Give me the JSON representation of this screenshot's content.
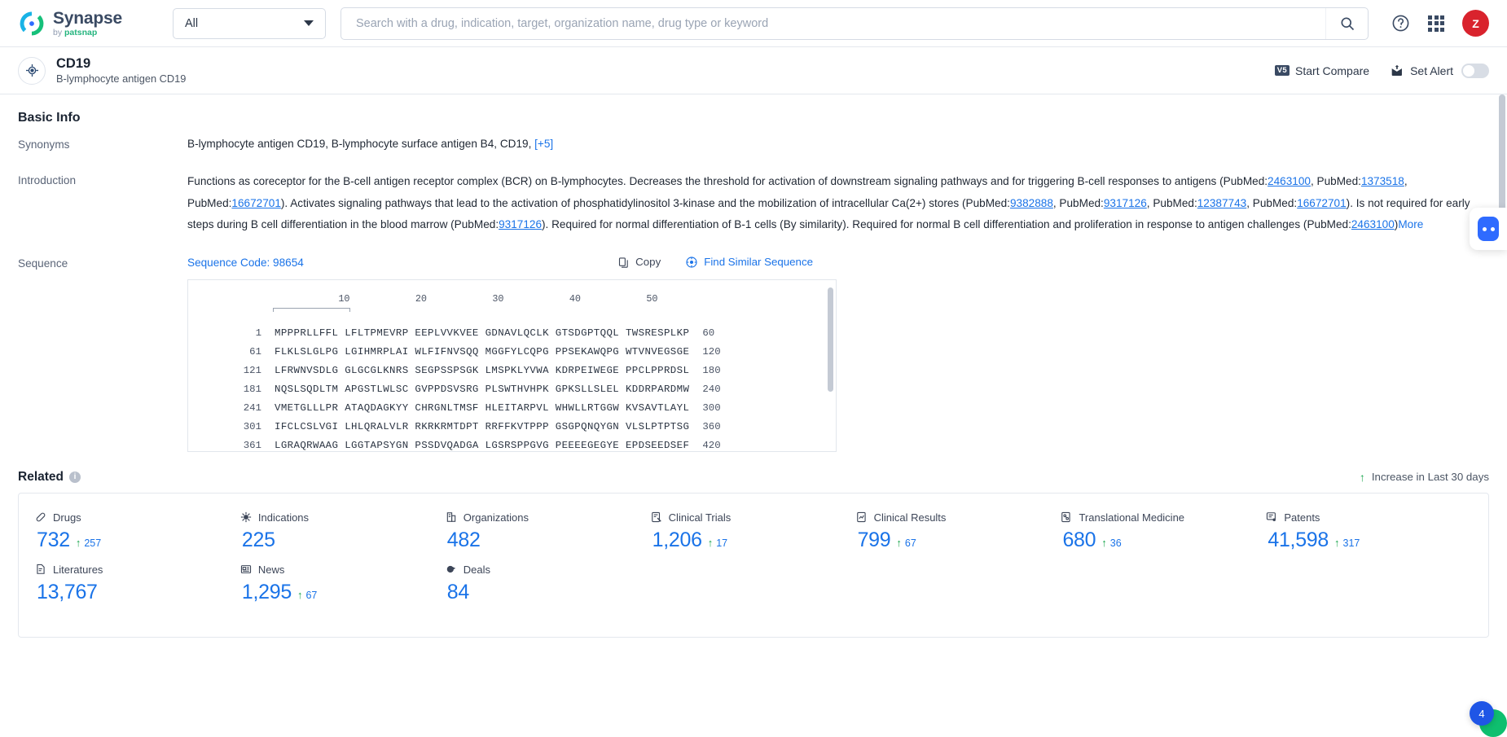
{
  "brand": {
    "name": "Synapse",
    "by": "by",
    "company": "patsnap",
    "logo_icon": "synapse-logo-icon"
  },
  "topbar": {
    "scope_value": "All",
    "scope_caret_icon": "chevron-down-icon",
    "search_placeholder": "Search with a drug, indication, target, organization name, drug type or keyword",
    "search_value": "",
    "search_icon": "search-icon",
    "help_icon": "help-circle-icon",
    "apps_icon": "apps-grid-icon",
    "avatar_initial": "Z"
  },
  "subheader": {
    "target_icon": "target-crosshair-icon",
    "title": "CD19",
    "subtitle": "B-lymphocyte antigen CD19",
    "start_compare_label": "Start Compare",
    "start_compare_badge": "V5",
    "set_alert_label": "Set Alert",
    "set_alert_icon": "bell-alert-icon",
    "alert_toggle_state": "off"
  },
  "basic_info": {
    "heading": "Basic Info",
    "synonyms_label": "Synonyms",
    "synonyms_value": "B-lymphocyte antigen CD19,  B-lymphocyte surface antigen B4,  CD19,",
    "synonyms_more": "[+5]",
    "introduction_label": "Introduction",
    "introduction_parts": {
      "t1": "Functions as coreceptor for the B-cell antigen receptor complex (BCR) on B-lymphocytes. Decreases the threshold for activation of downstream signaling pathways and for triggering B-cell responses to antigens (PubMed:",
      "l1": "2463100",
      "t2": ", PubMed:",
      "l2": "1373518",
      "t3": ", PubMed:",
      "l3": "16672701",
      "t4": "). Activates signaling pathways that lead to the activation of phosphatidylinositol 3-kinase and the mobilization of intracellular Ca(2+) stores (PubMed:",
      "l4": "9382888",
      "t5": ", PubMed:",
      "l5": "9317126",
      "t6": ", PubMed:",
      "l6": "12387743",
      "t7": ", PubMed:",
      "l7": "16672701",
      "t8": "). Is not required for early steps during B cell differentiation in the blood marrow (PubMed:",
      "l8": "9317126",
      "t9": "). Required for normal differentiation of B-1 cells (By similarity). Required for normal B cell differentiation and proliferation in response to antigen challenges (PubMed:",
      "l9": "2463100",
      "t10": ")",
      "more": "More"
    }
  },
  "sequence": {
    "label": "Sequence",
    "code_label": "Sequence Code: 98654",
    "copy_label": "Copy",
    "copy_icon": "copy-icon",
    "find_similar_label": "Find Similar Sequence",
    "find_similar_icon": "find-similar-icon",
    "ruler_ticks": [
      "10",
      "20",
      "30",
      "40",
      "50"
    ],
    "lines": [
      {
        "start": "1",
        "chunks": "MPPPRLLFFL LFLTPMEVRP EEPLVVKVEE GDNAVLQCLK GTSDGPTQQL TWSRESPLKP",
        "end": "60"
      },
      {
        "start": "61",
        "chunks": "FLKLSLGLPG LGIHMRPLAI WLFIFNVSQQ MGGFYLCQPG PPSEKAWQPG WTVNVEGSGE",
        "end": "120"
      },
      {
        "start": "121",
        "chunks": "LFRWNVSDLG GLGCGLKNRS SEGPSSPSGK LMSPKLYVWA KDRPEIWEGE PPCLPPRDSL",
        "end": "180"
      },
      {
        "start": "181",
        "chunks": "NQSLSQDLTM APGSTLWLSC GVPPDSVSRG PLSWTHVHPK GPKSLLSLEL KDDRPARDMW",
        "end": "240"
      },
      {
        "start": "241",
        "chunks": "VMETGLLLPR ATAQDAGKYY CHRGNLTMSF HLEITARPVL WHWLLRTGGW KVSAVTLAYL",
        "end": "300"
      },
      {
        "start": "301",
        "chunks": "IFCLCSLVGI LHLQRALVLR RKRKRMTDPT RRFFKVTPPP GSGPQNQYGN VLSLPTPTSG",
        "end": "360"
      },
      {
        "start": "361",
        "chunks": "LGRAQRWAAG LGGTAPSYGN PSSDVQADGA LGSRSPPGVG PEEEEGEGYE EPDSEEDSEF",
        "end": "420"
      }
    ]
  },
  "related": {
    "title": "Related",
    "info_icon": "info-icon",
    "increase_note": "Increase in Last 30 days",
    "increase_arrow_icon": "arrow-up-icon",
    "stats": [
      {
        "icon": "pill-icon",
        "label": "Drugs",
        "value": "732",
        "delta": "257"
      },
      {
        "icon": "virus-icon",
        "label": "Indications",
        "value": "225",
        "delta": ""
      },
      {
        "icon": "building-icon",
        "label": "Organizations",
        "value": "482",
        "delta": ""
      },
      {
        "icon": "clinical-trial-icon",
        "label": "Clinical Trials",
        "value": "1,206",
        "delta": "17"
      },
      {
        "icon": "clinical-result-icon",
        "label": "Clinical Results",
        "value": "799",
        "delta": "67"
      },
      {
        "icon": "translational-icon",
        "label": "Translational Medicine",
        "value": "680",
        "delta": "36"
      },
      {
        "icon": "patent-icon",
        "label": "Patents",
        "value": "41,598",
        "delta": "317"
      },
      {
        "icon": "literature-icon",
        "label": "Literatures",
        "value": "13,767",
        "delta": ""
      },
      {
        "icon": "news-icon",
        "label": "News",
        "value": "1,295",
        "delta": "67"
      },
      {
        "icon": "deal-icon",
        "label": "Deals",
        "value": "84",
        "delta": ""
      }
    ]
  },
  "floating": {
    "assistant_icon": "ai-assistant-icon",
    "badge_count": "4",
    "chat_icon": "chat-bubble-icon"
  },
  "colors": {
    "accent_blue": "#1a73e8",
    "green": "#1ea750",
    "avatar_red": "#d9232d",
    "brand_dark": "#3a4a63"
  }
}
